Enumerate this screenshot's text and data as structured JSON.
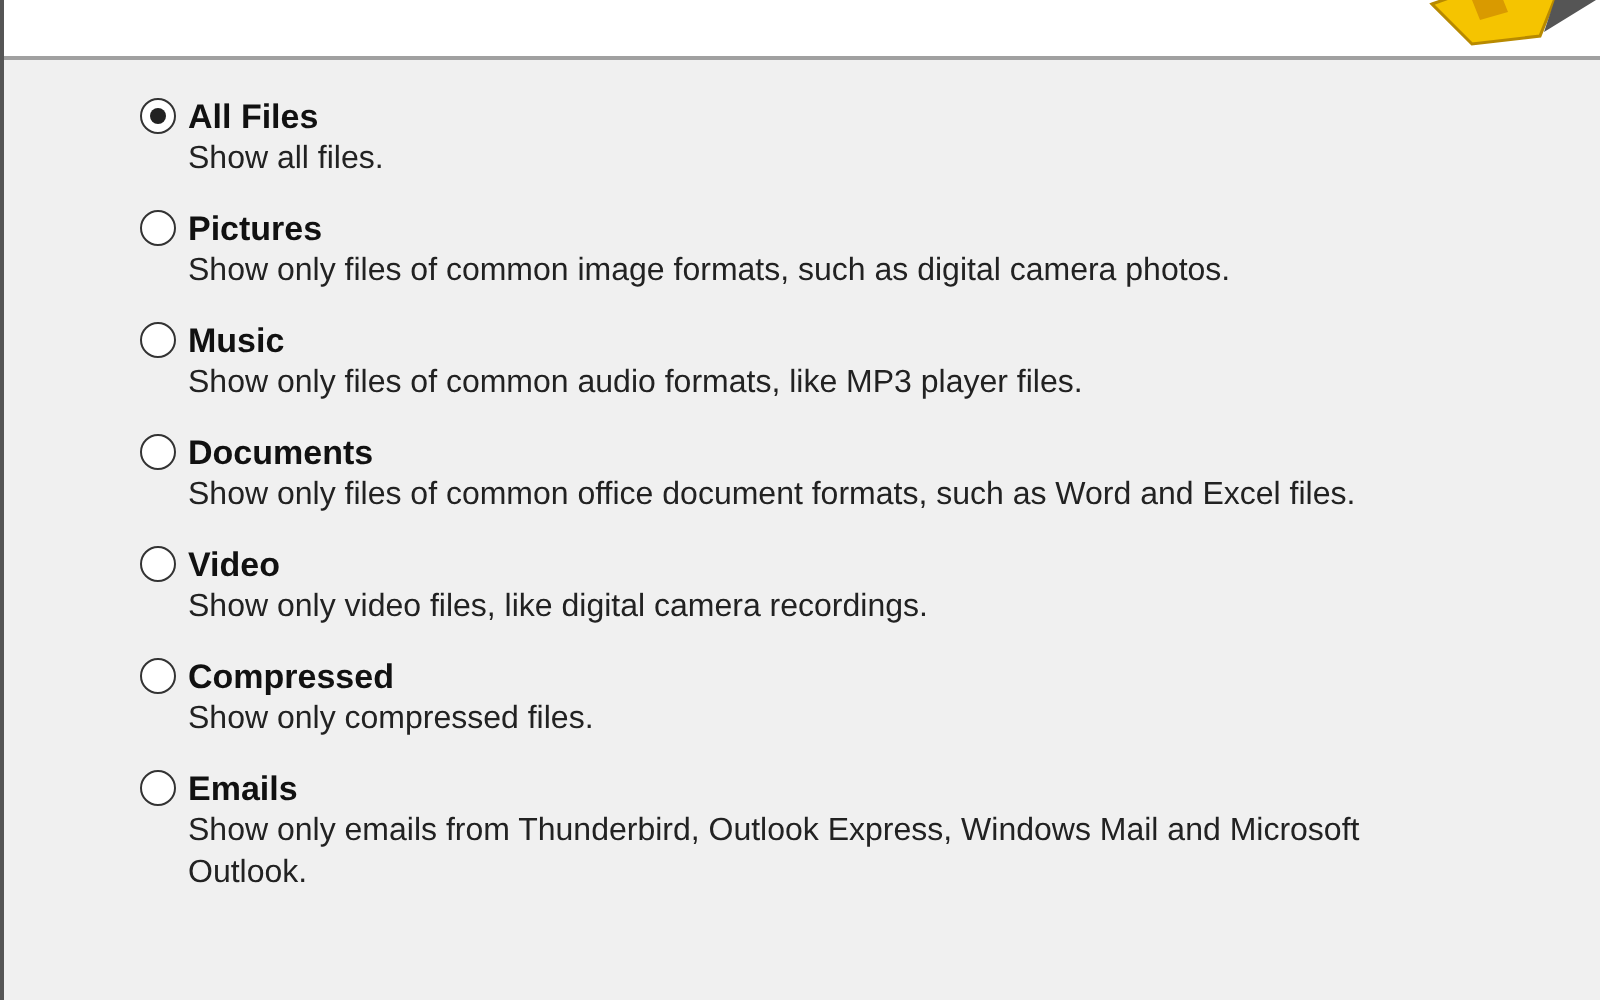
{
  "options": [
    {
      "label": "All Files",
      "description": "Show all files.",
      "selected": true
    },
    {
      "label": "Pictures",
      "description": "Show only files of common image formats, such as digital camera photos.",
      "selected": false
    },
    {
      "label": "Music",
      "description": "Show only files of common audio formats, like MP3 player files.",
      "selected": false
    },
    {
      "label": "Documents",
      "description": "Show only files of common office document formats, such as Word and Excel files.",
      "selected": false
    },
    {
      "label": "Video",
      "description": "Show only video files, like digital camera recordings.",
      "selected": false
    },
    {
      "label": "Compressed",
      "description": "Show only compressed files.",
      "selected": false
    },
    {
      "label": "Emails",
      "description": "Show only emails from Thunderbird, Outlook Express, Windows Mail and Microsoft Outlook.",
      "selected": false
    }
  ]
}
